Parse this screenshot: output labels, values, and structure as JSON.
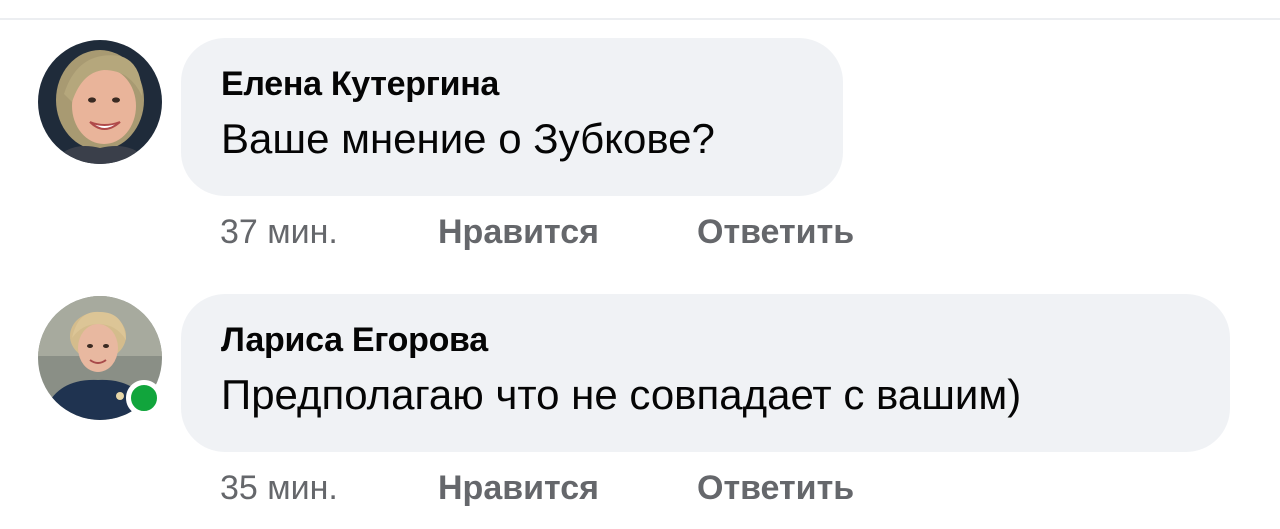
{
  "comments": [
    {
      "author": "Елена Кутергина",
      "text": "Ваше мнение о Зубкове?",
      "time": "37 мин.",
      "like_label": "Нравится",
      "reply_label": "Ответить",
      "online": false
    },
    {
      "author": "Лариса Егорова",
      "text": "Предполагаю что не совпадает с вашим)",
      "time": "35 мин.",
      "like_label": "Нравится",
      "reply_label": "Ответить",
      "online": true
    }
  ],
  "colors": {
    "bubble_background": "#f0f2f5",
    "primary_text": "#050505",
    "secondary_text": "#65676b",
    "online_indicator": "#11a53c"
  }
}
